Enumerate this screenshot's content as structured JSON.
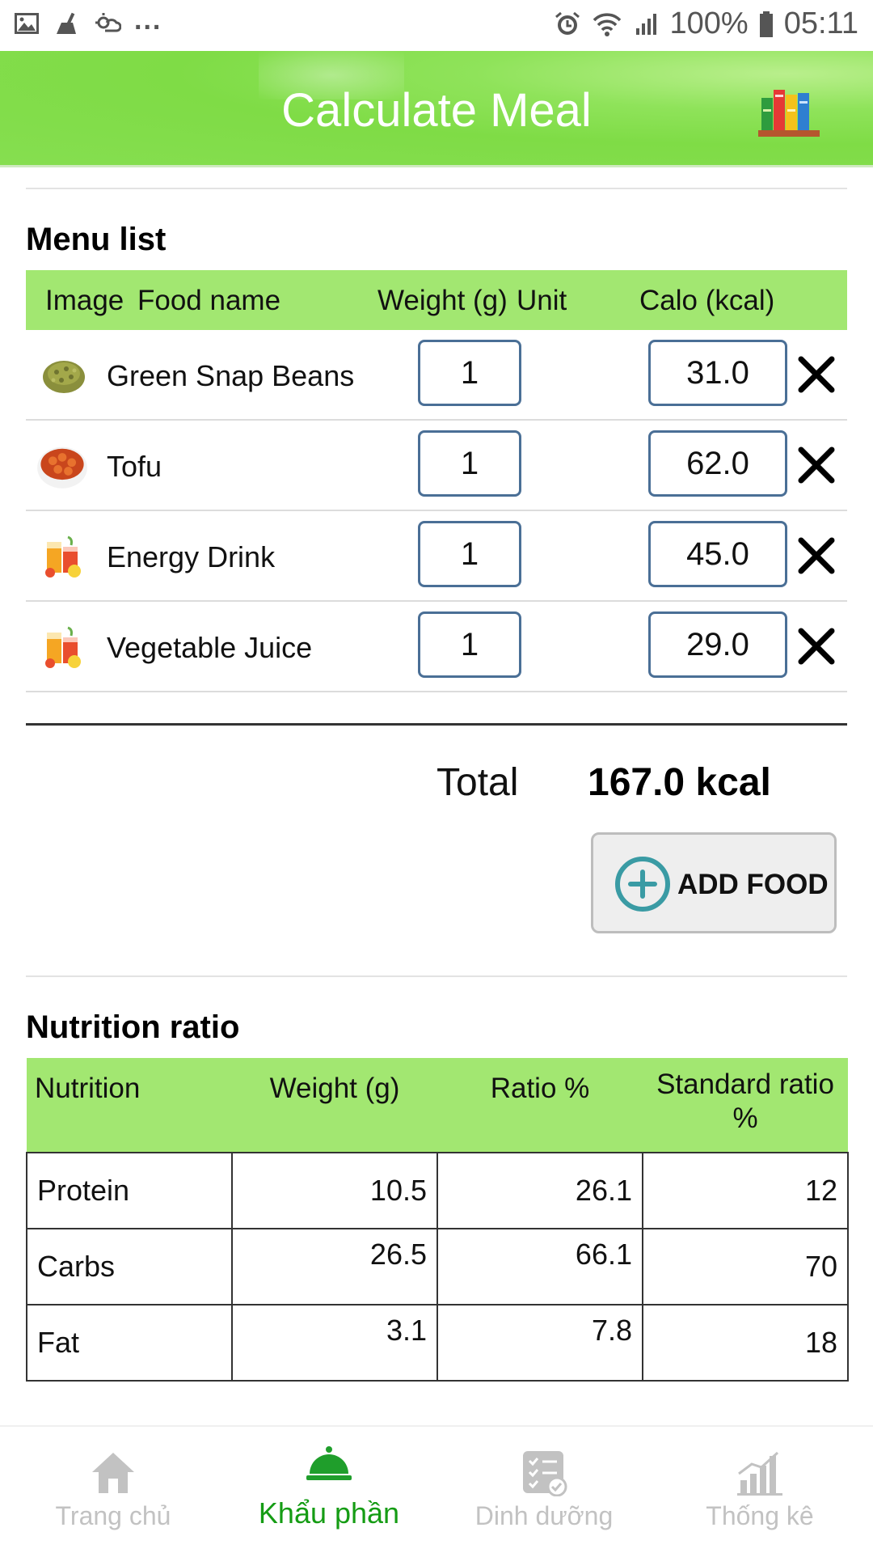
{
  "status_bar": {
    "battery": "100%",
    "time": "05:11",
    "more": "..."
  },
  "header": {
    "title": "Calculate Meal",
    "icon": "books-icon"
  },
  "menu_list": {
    "title": "Menu list",
    "columns": {
      "image": "Image",
      "food_name": "Food name",
      "weight": "Weight (g)",
      "unit": "Unit",
      "calo": "Calo (kcal)"
    },
    "items": [
      {
        "name": "Green Snap Beans",
        "weight": "1",
        "calo": "31.0",
        "icon": "beans-image"
      },
      {
        "name": "Tofu",
        "weight": "1",
        "calo": "62.0",
        "icon": "tofu-bowl-image"
      },
      {
        "name": "Energy Drink",
        "weight": "1",
        "calo": "45.0",
        "icon": "juice-glasses-image"
      },
      {
        "name": "Vegetable Juice",
        "weight": "1",
        "calo": "29.0",
        "icon": "juice-glasses-image"
      }
    ],
    "total_label": "Total",
    "total_value": "167.0 kcal",
    "add_button": "ADD FOOD"
  },
  "nutrition": {
    "title": "Nutrition ratio",
    "columns": {
      "nutrition": "Nutrition",
      "weight": "Weight (g)",
      "ratio": "Ratio %",
      "standard": "Standard ratio %"
    },
    "rows": [
      {
        "name": "Protein",
        "weight": "10.5",
        "ratio": "26.1",
        "standard": "12"
      },
      {
        "name": "Carbs",
        "weight": "26.5",
        "ratio": "66.1",
        "standard": "70"
      },
      {
        "name": "Fat",
        "weight": "3.1",
        "ratio": "7.8",
        "standard": "18"
      }
    ]
  },
  "bottom_nav": {
    "items": [
      {
        "label": "Trang chủ",
        "icon": "home-icon",
        "active": false
      },
      {
        "label": "Khẩu phần",
        "icon": "food-cloche-icon",
        "active": true
      },
      {
        "label": "Dinh dưỡng",
        "icon": "checklist-icon",
        "active": false
      },
      {
        "label": "Thống kê",
        "icon": "stats-chart-icon",
        "active": false
      }
    ]
  },
  "colors": {
    "header_green": "#7fdc46",
    "table_header_green": "#a2e771",
    "active_nav": "#159c14",
    "inactive_nav": "#c2c2c2",
    "input_border": "#4a6f96",
    "add_icon": "#3a9ba4"
  }
}
